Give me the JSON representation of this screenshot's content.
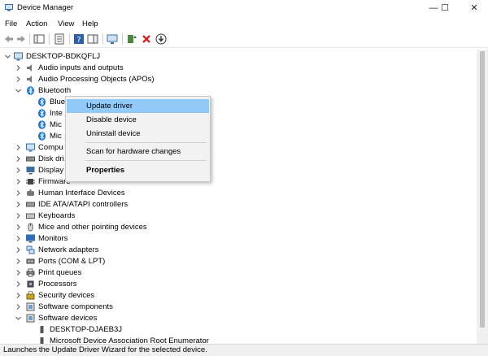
{
  "window": {
    "title": "Device Manager",
    "minimize_glyph": "—",
    "maximize_glyph": "☐",
    "close_glyph": "✕"
  },
  "menu": [
    "File",
    "Action",
    "View",
    "Help"
  ],
  "toolbar": [
    "back-icon",
    "forward-icon",
    "show-hide-console-tree-icon",
    "properties-icon",
    "help-icon",
    "action-pane-icon",
    "scan-hardware-icon",
    "update-driver-icon",
    "uninstall-device-icon",
    "disable-device-icon"
  ],
  "tree": {
    "root": "DESKTOP-BDKQFLJ",
    "items": [
      {
        "label": "Audio inputs and outputs",
        "icon": "speaker-icon"
      },
      {
        "label": "Audio Processing Objects (APOs)",
        "icon": "speaker-icon"
      },
      {
        "label": "Bluetooth",
        "icon": "bluetooth-icon",
        "expanded": true,
        "children": [
          {
            "label": "Blue",
            "icon": "bluetooth-icon"
          },
          {
            "label": "Inte",
            "icon": "bluetooth-icon"
          },
          {
            "label": "Mic",
            "icon": "bluetooth-icon"
          },
          {
            "label": "Mic",
            "icon": "bluetooth-icon"
          }
        ]
      },
      {
        "label": "Compu",
        "icon": "computer-icon"
      },
      {
        "label": "Disk dri",
        "icon": "disk-drive-icon"
      },
      {
        "label": "Display",
        "icon": "display-adapter-icon"
      },
      {
        "label": "Firmware",
        "icon": "firmware-icon"
      },
      {
        "label": "Human Interface Devices",
        "icon": "hid-icon"
      },
      {
        "label": "IDE ATA/ATAPI controllers",
        "icon": "ide-icon"
      },
      {
        "label": "Keyboards",
        "icon": "keyboard-icon"
      },
      {
        "label": "Mice and other pointing devices",
        "icon": "mouse-icon"
      },
      {
        "label": "Monitors",
        "icon": "monitor-icon"
      },
      {
        "label": "Network adapters",
        "icon": "network-icon"
      },
      {
        "label": "Ports (COM & LPT)",
        "icon": "port-icon"
      },
      {
        "label": "Print queues",
        "icon": "printer-icon"
      },
      {
        "label": "Processors",
        "icon": "processor-icon"
      },
      {
        "label": "Security devices",
        "icon": "security-icon"
      },
      {
        "label": "Software components",
        "icon": "software-icon"
      },
      {
        "label": "Software devices",
        "icon": "software-icon",
        "expanded": true,
        "children": [
          {
            "label": "DESKTOP-DJAEB3J",
            "icon": "device-icon"
          },
          {
            "label": "Microsoft Device Association Root Enumerator",
            "icon": "device-icon"
          }
        ]
      }
    ]
  },
  "context_menu": {
    "items": [
      {
        "label": "Update driver",
        "highlighted": true
      },
      {
        "label": "Disable device"
      },
      {
        "label": "Uninstall device"
      },
      {
        "label": "Scan for hardware changes"
      },
      {
        "label": "Properties",
        "bold": true
      }
    ]
  },
  "status": "Launches the Update Driver Wizard for the selected device.",
  "colors": {
    "highlight": "#91c9f7",
    "bluetooth": "#1a73d9",
    "accent": "#3478c6"
  }
}
